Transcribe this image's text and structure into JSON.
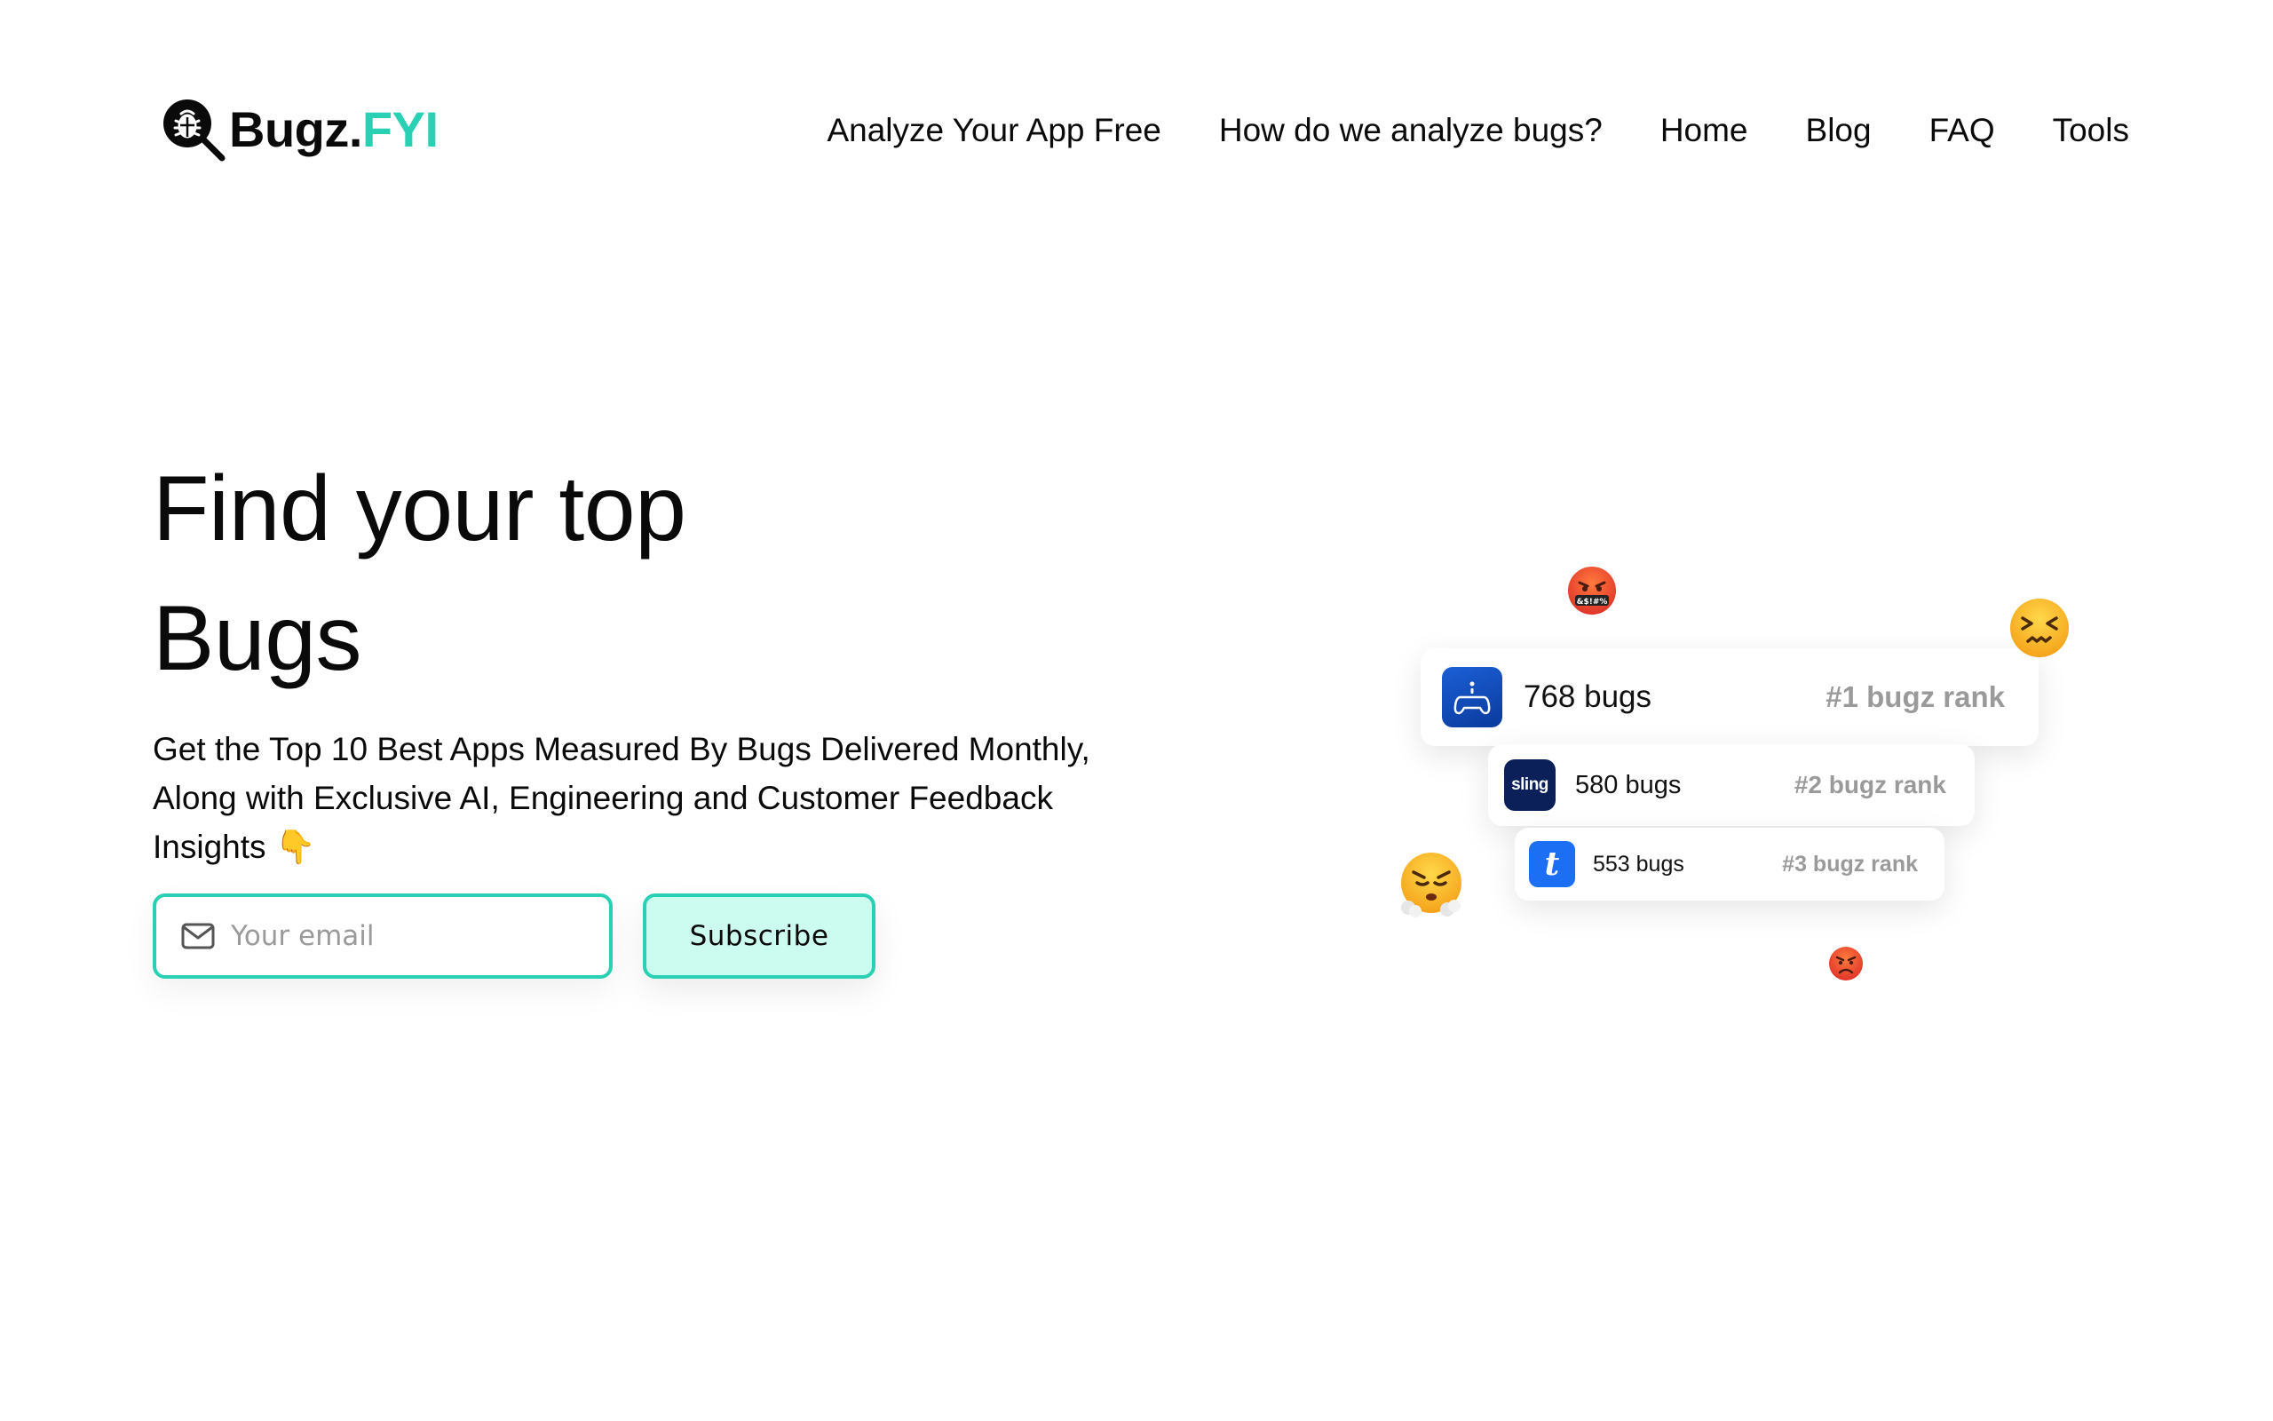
{
  "brand": {
    "name_main": "Bugz.",
    "name_accent": "FYI",
    "accent_color": "#2ad0b4",
    "logo_icon": "bug-magnifier-icon"
  },
  "nav": {
    "items": [
      {
        "label": "Analyze Your App Free"
      },
      {
        "label": "How do we analyze bugs?"
      },
      {
        "label": "Home"
      },
      {
        "label": "Blog"
      },
      {
        "label": "FAQ"
      },
      {
        "label": "Tools"
      }
    ]
  },
  "hero": {
    "title_line1": "Find your top",
    "title_line2": "Bugs",
    "subtitle": "Get the Top 10 Best Apps Measured By Bugs Delivered Monthly, Along with Exclusive AI, Engineering and Customer Feedback Insights",
    "subtitle_emoji": "👇",
    "email_placeholder": "Your email",
    "email_icon": "mail-icon",
    "subscribe_label": "Subscribe"
  },
  "rank_cards": [
    {
      "app_icon": "gamepad-app-icon",
      "bugs": "768 bugs",
      "rank": "#1 bugz rank"
    },
    {
      "app_icon": "sling-app-icon",
      "icon_text": "sling",
      "bugs": "580 bugs",
      "rank": "#2 bugz rank"
    },
    {
      "app_icon": "t-app-icon",
      "icon_text": "t",
      "bugs": "553 bugs",
      "rank": "#3 bugz rank"
    }
  ],
  "emojis": [
    "cursing-face-emoji",
    "confounded-face-emoji",
    "steam-face-emoji",
    "angry-face-emoji"
  ]
}
